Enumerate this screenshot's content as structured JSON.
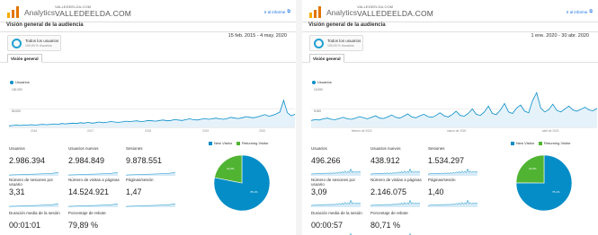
{
  "colors": {
    "accent": "#058dc7",
    "new_visitor": "#058dc7",
    "returning_visitor": "#50b432",
    "link": "#1a73e8"
  },
  "panels": [
    {
      "brand": "Analytics",
      "account": "VALLEDEELDA.COM",
      "site": "VALLEDEELDA.COM",
      "report_link": "Ir al informe",
      "page_title": "Visión general de la audiencia",
      "segment": {
        "name": "Todos los usuarios",
        "sub": "100,00 % Usuarios"
      },
      "date_range": "15 feb. 2015 - 4 may. 2020",
      "tab": "Visión general",
      "legend": "Usuarios",
      "y_top": "100.000",
      "y_mid": "50.000",
      "x_labels": [
        "2016",
        "2017",
        "2018",
        "2019",
        "2020"
      ],
      "metrics": [
        {
          "label": "Usuarios",
          "value": "2.986.394"
        },
        {
          "label": "Usuarios nuevos",
          "value": "2.984.849"
        },
        {
          "label": "Sesiones",
          "value": "9.878.551"
        },
        {
          "label": "Número de sesiones por usuario",
          "value": "3,31"
        },
        {
          "label": "Número de visitas a páginas",
          "value": "14.524.921"
        },
        {
          "label": "Páginas/sesión",
          "value": "1,47"
        },
        {
          "label": "Duración media de la sesión",
          "value": "00:01:01"
        },
        {
          "label": "Porcentaje de rebote",
          "value": "79,89 %"
        }
      ],
      "pie_legend": {
        "new": "New Visitor",
        "returning": "Returning Visitor"
      },
      "pie_values": {
        "new": 78.1,
        "returning": 21.9
      },
      "pie_labels": {
        "new": "78,1%",
        "returning": "21,9%"
      },
      "series": [
        4,
        5,
        6,
        5,
        6,
        6,
        7,
        6,
        7,
        8,
        7,
        8,
        9,
        8,
        10,
        9,
        10,
        11,
        10,
        12,
        11,
        13,
        11,
        12,
        14,
        12,
        13,
        15,
        14,
        13,
        14,
        16,
        15,
        16,
        17,
        15,
        16,
        18,
        17,
        16,
        18,
        19,
        17,
        18,
        20,
        19,
        18,
        20,
        22,
        20,
        19,
        21,
        23,
        21,
        22,
        24,
        22,
        21,
        23,
        26,
        24,
        23,
        25,
        28,
        26,
        25,
        27,
        30,
        33,
        29,
        31,
        35,
        40,
        70,
        38,
        30,
        34
      ]
    },
    {
      "brand": "Analytics",
      "account": "VALLEDEELDA.COM",
      "site": "VALLEDEELDA.COM",
      "report_link": "Ir al informe",
      "page_title": "Visión general de la audiencia",
      "segment": {
        "name": "Todos los usuarios",
        "sub": "100,00 % Usuarios"
      },
      "date_range": "1 ene. 2020 - 30 abr. 2020",
      "tab": "Visión general",
      "legend": "Usuarios",
      "y_top": "10.000",
      "y_mid": "5.000",
      "x_labels": [
        "febrero de 2020",
        "marzo de 2020",
        "abril de 2020"
      ],
      "metrics": [
        {
          "label": "Usuarios",
          "value": "496.266"
        },
        {
          "label": "Usuarios nuevos",
          "value": "438.912"
        },
        {
          "label": "Sesiones",
          "value": "1.534.297"
        },
        {
          "label": "Número de sesiones por usuario",
          "value": "3,09"
        },
        {
          "label": "Número de visitas a páginas",
          "value": "2.146.075"
        },
        {
          "label": "Páginas/sesión",
          "value": "1,40"
        },
        {
          "label": "Duración media de la sesión",
          "value": "00:00:57"
        },
        {
          "label": "Porcentaje de rebote",
          "value": "80,71 %"
        }
      ],
      "pie_legend": {
        "new": "New Visitor",
        "returning": "Returning Visitor"
      },
      "pie_values": {
        "new": 75.1,
        "returning": 24.9
      },
      "pie_labels": {
        "new": "75,1%",
        "returning": "24,9%"
      },
      "series": [
        18,
        20,
        19,
        22,
        24,
        21,
        20,
        23,
        26,
        22,
        21,
        24,
        28,
        25,
        22,
        26,
        30,
        24,
        23,
        27,
        32,
        26,
        24,
        29,
        35,
        27,
        25,
        30,
        34,
        28,
        26,
        31,
        38,
        30,
        27,
        33,
        42,
        31,
        29,
        36,
        48,
        34,
        31,
        40,
        55,
        36,
        33,
        45,
        62,
        40,
        36,
        50,
        58,
        42,
        38,
        70,
        90,
        50,
        40,
        46,
        60,
        44,
        40,
        48,
        55,
        45,
        42,
        47,
        52,
        45,
        43,
        49
      ]
    }
  ]
}
